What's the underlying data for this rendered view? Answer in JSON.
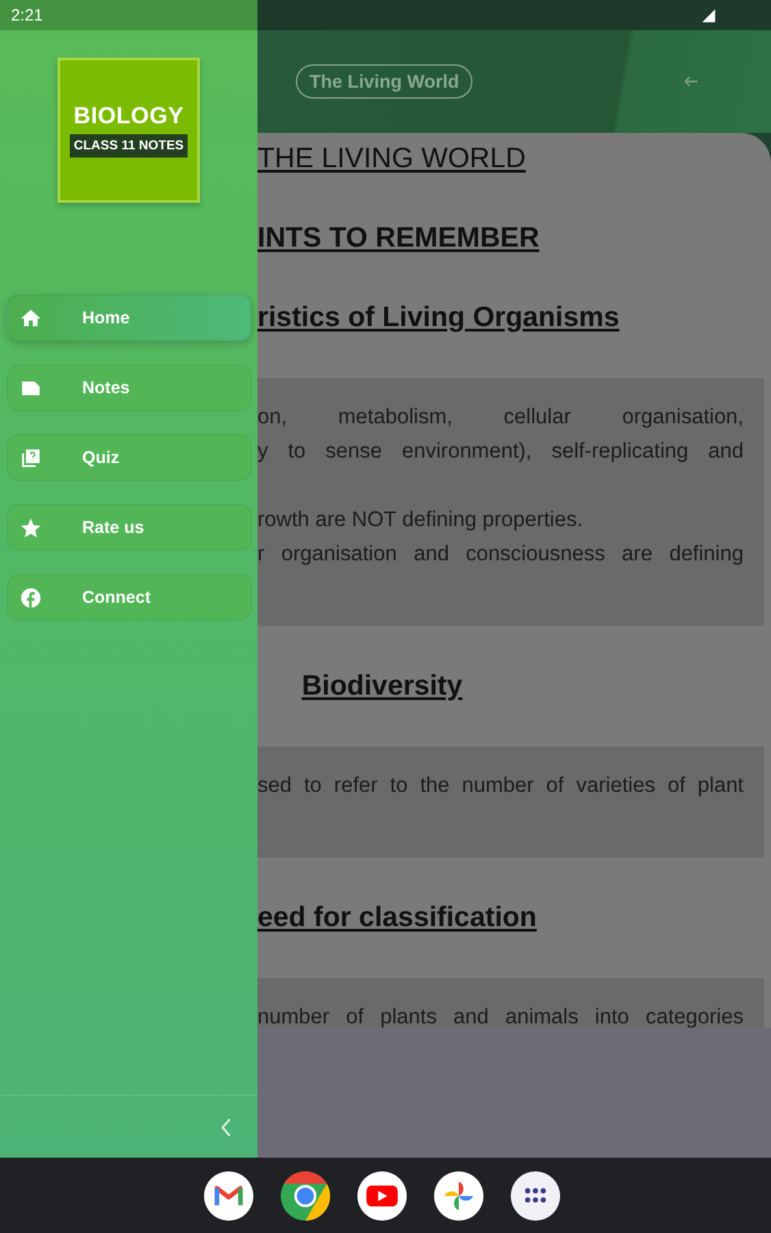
{
  "status_bar": {
    "time": "2:21"
  },
  "drawer": {
    "logo": {
      "title": "BIOLOGY",
      "subtitle": "CLASS 11 NOTES"
    },
    "items": [
      {
        "label": "Home",
        "kind": "home",
        "selected": true
      },
      {
        "label": "Notes",
        "kind": "note",
        "selected": false
      },
      {
        "label": "Quiz",
        "kind": "quiz",
        "selected": false
      },
      {
        "label": "Rate us",
        "kind": "star",
        "selected": false
      },
      {
        "label": "Connect",
        "kind": "facebook",
        "selected": false
      }
    ]
  },
  "header": {
    "title": "The Living World"
  },
  "content": [
    {
      "kind": "heading",
      "text": "THE LIVING WORLD",
      "clipped": true
    },
    {
      "kind": "heading",
      "text": "INTS TO REMEMBER",
      "clipped": true
    },
    {
      "kind": "heading",
      "text": "ristics of Living Organisms",
      "clipped": true
    },
    {
      "kind": "box",
      "paragraphs": [
        {
          "lines": [
            {
              "text": "on,   metabolism,   cellular   organisation,",
              "justified": true
            },
            {
              "text": "y to sense environment), self-replicating and",
              "justified": true
            }
          ]
        },
        {
          "lines": [
            {
              "text": "rowth are NOT defining properties.",
              "justified": false
            },
            {
              "text": "r organisation and consciousness are defining",
              "justified": true
            }
          ]
        }
      ]
    },
    {
      "kind": "heading",
      "text": "Biodiversity",
      "clipped": false
    },
    {
      "kind": "box",
      "paragraphs": [
        {
          "lines": [
            {
              "text": "sed to refer to the number of varieties of plant",
              "justified": true
            }
          ]
        }
      ]
    },
    {
      "kind": "heading",
      "text": "eed for classification",
      "clipped": true
    },
    {
      "kind": "box",
      "paragraphs": [
        {
          "lines": [
            {
              "text": "number of plants and animals into categories",
              "justified": true
            }
          ]
        }
      ]
    }
  ],
  "dock": {
    "apps": [
      {
        "kind": "mail"
      },
      {
        "kind": "browser"
      },
      {
        "kind": "video"
      },
      {
        "kind": "photos"
      },
      {
        "kind": "apps"
      }
    ]
  }
}
